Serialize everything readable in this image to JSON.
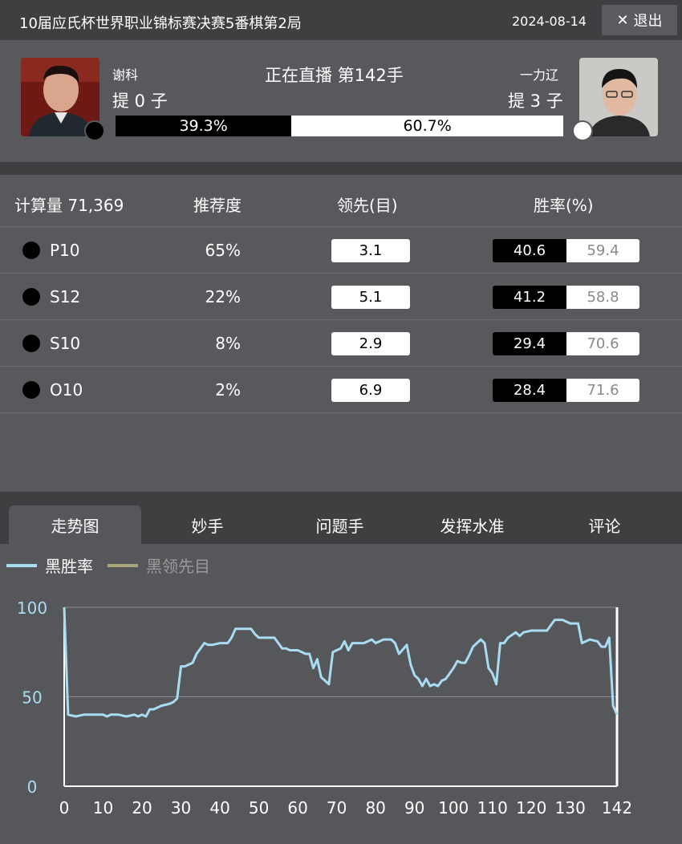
{
  "header": {
    "title": "10届应氏杯世界职业锦标赛决赛5番棋第2局",
    "date": "2024-08-14",
    "exit_label": "退出"
  },
  "players": {
    "black": {
      "name": "谢科",
      "captured": "提 0 子",
      "stone": "black"
    },
    "white": {
      "name": "一力辽",
      "captured": "提 3 子",
      "stone": "white"
    },
    "status": "正在直播 第142手",
    "winrate_black": "39.3%",
    "winrate_white": "60.7%",
    "winrate_black_value": 39.3
  },
  "analysis": {
    "headers": {
      "computation": "计算量 71,369",
      "recommend": "推荐度",
      "lead": "领先(目)",
      "winrate": "胜率(%)"
    },
    "rows": [
      {
        "move": "P10",
        "recommend": "65%",
        "lead": "3.1",
        "win_black": "40.6",
        "win_white": "59.4"
      },
      {
        "move": "S12",
        "recommend": "22%",
        "lead": "5.1",
        "win_black": "41.2",
        "win_white": "58.8"
      },
      {
        "move": "S10",
        "recommend": "8%",
        "lead": "2.9",
        "win_black": "29.4",
        "win_white": "70.6"
      },
      {
        "move": "O10",
        "recommend": "2%",
        "lead": "6.9",
        "win_black": "28.4",
        "win_white": "71.6"
      }
    ]
  },
  "tabs": [
    {
      "label": "走势图",
      "active": true
    },
    {
      "label": "妙手",
      "active": false
    },
    {
      "label": "问题手",
      "active": false
    },
    {
      "label": "发挥水准",
      "active": false
    },
    {
      "label": "评论",
      "active": false
    }
  ],
  "colors": {
    "black_winrate_line": "#a9dcf2",
    "black_lead_line": "#a8a67a",
    "inactive_legend_text": "#9a9a9a"
  },
  "chart_data": {
    "type": "line",
    "legend": [
      "黑胜率",
      "黑领先目"
    ],
    "legend_active": [
      true,
      false
    ],
    "xlim": [
      0,
      142
    ],
    "ylim": [
      0,
      100
    ],
    "x_ticks": [
      0,
      10,
      20,
      30,
      40,
      50,
      60,
      70,
      80,
      90,
      100,
      110,
      120,
      130,
      142
    ],
    "y_ticks": [
      0,
      50,
      100
    ],
    "series": [
      {
        "name": "黑胜率",
        "x": [
          0,
          1,
          3,
          5,
          8,
          10,
          11,
          12,
          14,
          16,
          18,
          19,
          20,
          21,
          22,
          23,
          25,
          27,
          28,
          29,
          30,
          31,
          33,
          34,
          36,
          37,
          38,
          40,
          42,
          43,
          44,
          46,
          48,
          49,
          50,
          52,
          54,
          56,
          57,
          58,
          60,
          62,
          63,
          64,
          65,
          66,
          67,
          68,
          69,
          70,
          71,
          72,
          73,
          74,
          75,
          77,
          79,
          80,
          82,
          84,
          85,
          86,
          88,
          89,
          90,
          91,
          92,
          93,
          94,
          95,
          96,
          97,
          98,
          99,
          100,
          101,
          102,
          103,
          104,
          105,
          107,
          108,
          109,
          110,
          111,
          112,
          113,
          114,
          116,
          117,
          118,
          120,
          122,
          124,
          126,
          128,
          130,
          131,
          132,
          133,
          135,
          137,
          138,
          139,
          140,
          141,
          142
        ],
        "values": [
          100,
          40,
          39,
          40,
          40,
          40,
          39,
          40,
          40,
          39,
          40,
          39,
          40,
          39,
          43,
          43,
          45,
          46,
          47,
          49,
          67,
          67,
          69,
          74,
          80,
          79,
          79,
          80,
          80,
          83,
          88,
          88,
          88,
          85,
          83,
          83,
          83,
          77,
          77,
          76,
          76,
          74,
          74,
          66,
          71,
          61,
          59,
          57,
          75,
          76,
          77,
          81,
          76,
          80,
          80,
          80,
          82,
          80,
          82,
          82,
          80,
          74,
          79,
          68,
          62,
          60,
          56,
          60,
          56,
          57,
          56,
          59,
          60,
          63,
          66,
          70,
          69,
          69,
          73,
          78,
          82,
          80,
          66,
          63,
          57,
          80,
          80,
          83,
          86,
          84,
          86,
          87,
          87,
          87,
          93,
          93,
          91,
          91,
          91,
          80,
          82,
          81,
          78,
          78,
          83,
          45,
          40
        ]
      }
    ]
  }
}
